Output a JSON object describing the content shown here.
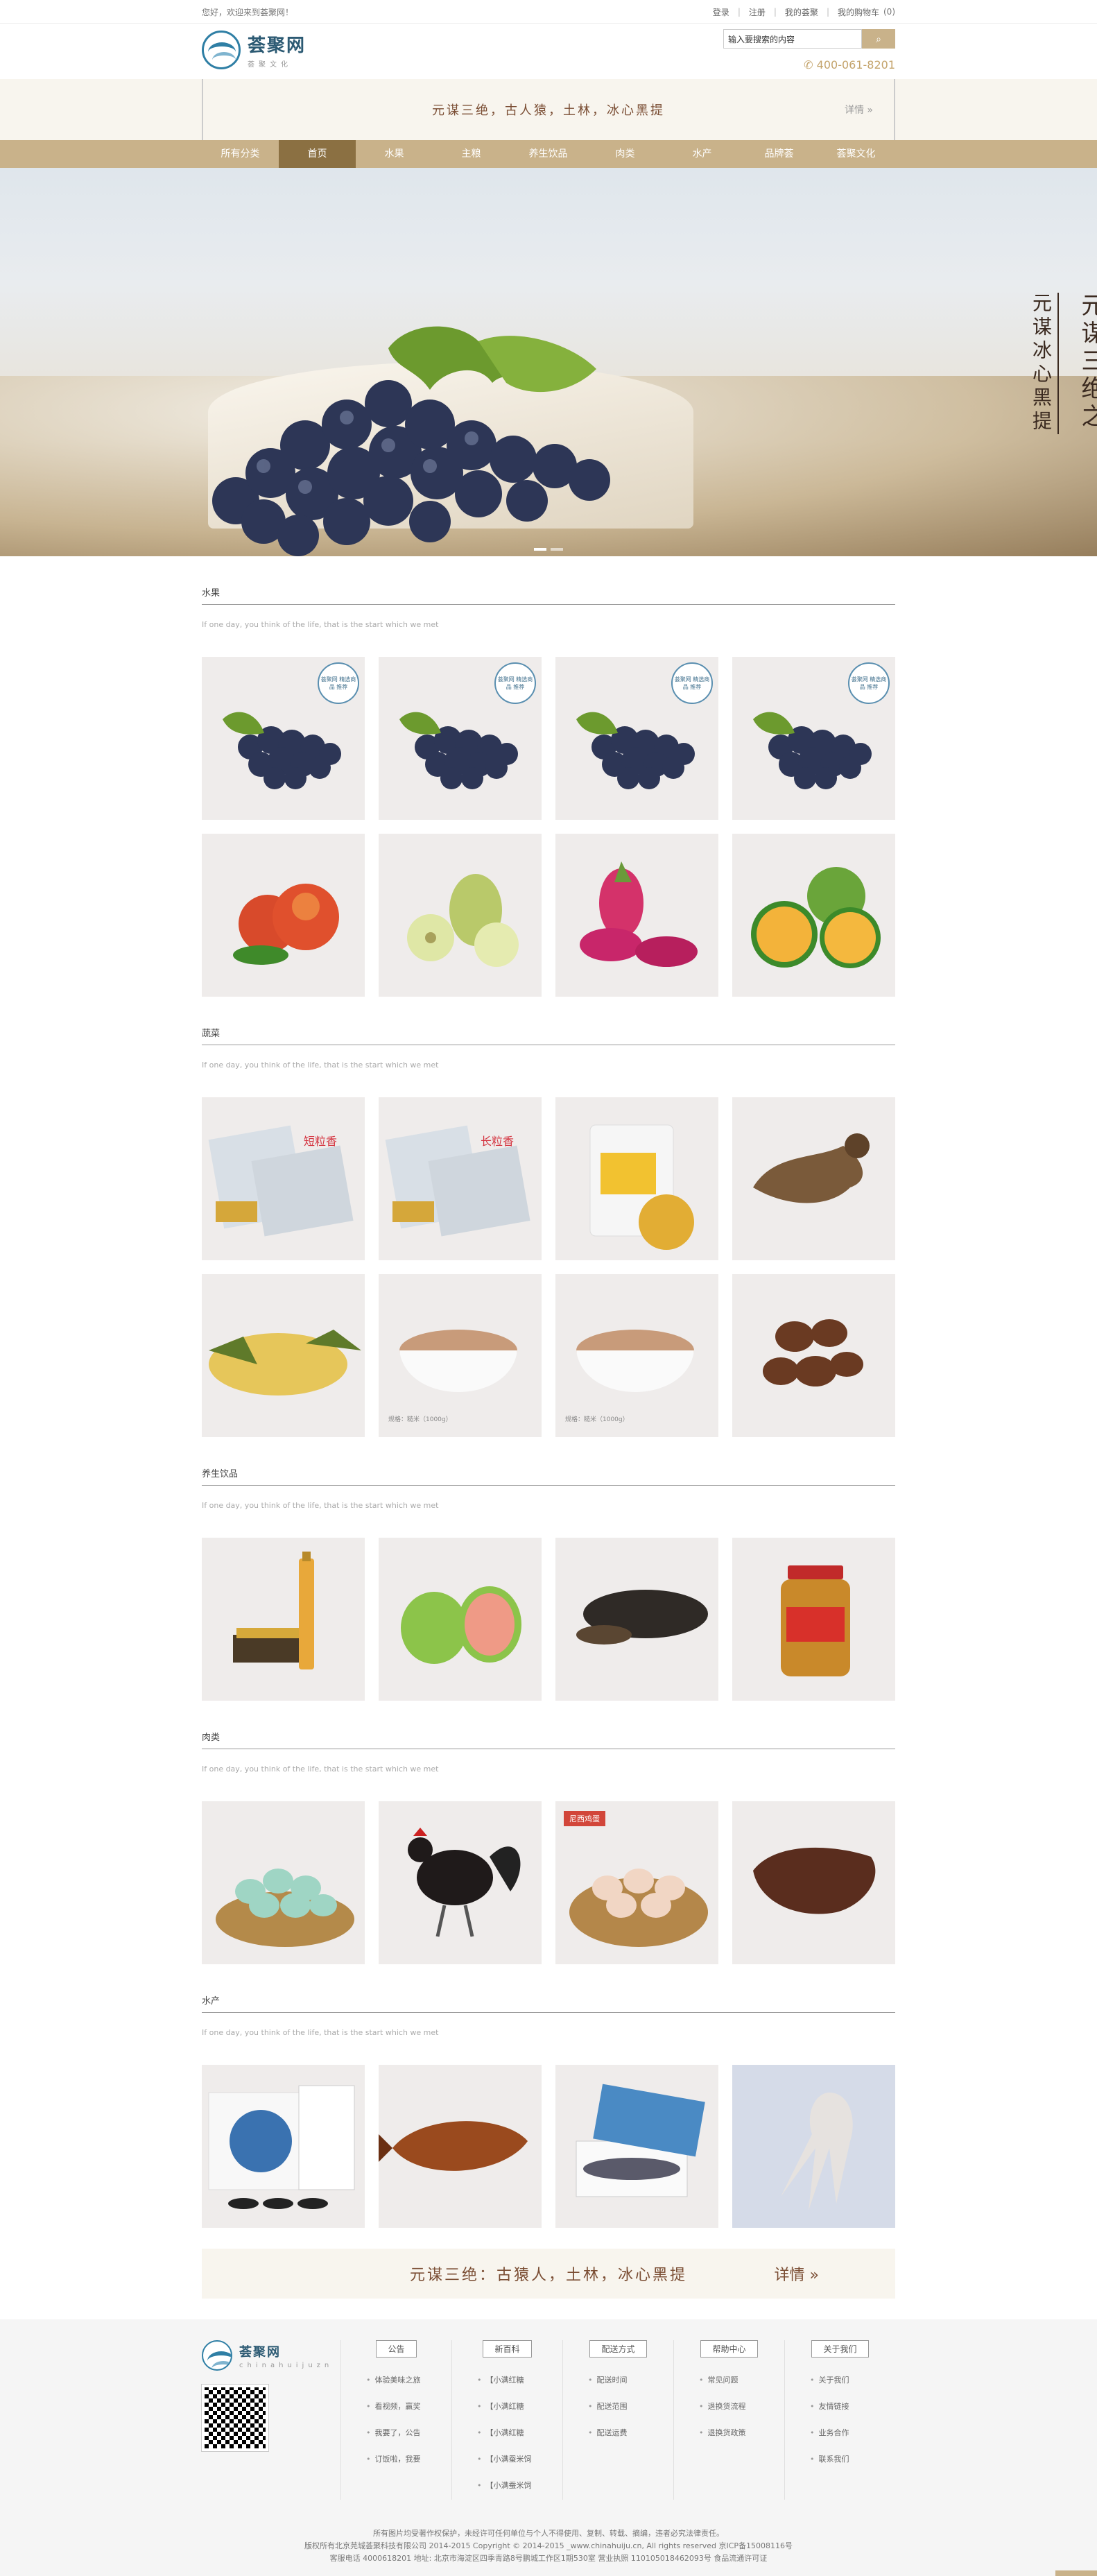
{
  "topbar": {
    "welcome": "您好，欢迎来到荟聚网！",
    "links": [
      "登录",
      "注册",
      "我的荟聚",
      "我的购物车"
    ],
    "cart_count": "(0)"
  },
  "header": {
    "logo_name": "荟聚网",
    "logo_sub": "荟聚文化",
    "search_placeholder": "输入要搜索的内容",
    "search_value": "输入要搜索的内容",
    "hotline": "400-061-8201"
  },
  "promo": {
    "text": "元谋三绝，古人猿，土林，冰心黑提",
    "more": "详情 »"
  },
  "nav": [
    "所有分类",
    "首页",
    "水果",
    "主粮",
    "养生饮品",
    "肉类",
    "水产",
    "品牌荟",
    "荟聚文化"
  ],
  "nav_active": 1,
  "banner": {
    "line1": "元谋三绝之",
    "line2": "元谋冰心黑提"
  },
  "sections": [
    {
      "title": "水果",
      "sub": "If one day, you think of the life, that is the start which we met"
    },
    {
      "title": "蔬菜",
      "sub": "If one day, you think of the life, that is the start which we met"
    },
    {
      "title": "养生饮品",
      "sub": "If one day, you think of the life, that is the start which we met"
    },
    {
      "title": "肉类",
      "sub": "If one day, you think of the life, that is the start which we met"
    },
    {
      "title": "水产",
      "sub": "If one day, you think of the life, that is the start which we met"
    }
  ],
  "cards": {
    "badge": "荟聚网\n精选商品\n推荐",
    "rice1": "短粒香",
    "rice2": "长粒香",
    "rice_caption": "规格：糙米（1000g）",
    "chicken_tag": "尼西鸡蛋"
  },
  "promo2": {
    "text": "元谋三绝：古猿人，土林，冰心黑提",
    "more": "详情 »"
  },
  "footer": {
    "logo_name": "荟聚网",
    "logo_sub": "chinahuijuzn",
    "columns": [
      {
        "head": "公告",
        "items": [
          "体验美味之旅",
          "看视频，赢奖",
          "我要了，公告",
          "订饭啦，我要"
        ]
      },
      {
        "head": "新百科",
        "items": [
          "【小满红糖",
          "【小满红糖",
          "【小满红糖",
          "【小满蚕米饲",
          "【小满蚕米饲"
        ]
      },
      {
        "head": "配送方式",
        "items": [
          "配送时间",
          "配送范围",
          "配送运费"
        ]
      },
      {
        "head": "帮助中心",
        "items": [
          "常见问题",
          "退换货流程",
          "退换货政策"
        ]
      },
      {
        "head": "关于我们",
        "items": [
          "关于我们",
          "友情链接",
          "业务合作",
          "联系我们"
        ]
      }
    ],
    "line1": "所有图片均受著作权保护，未经许可任何单位与个人不得使用、复制、转载、摘编，违者必究法律责任。",
    "line2": "版权所有北京芫城荟聚科技有限公司 2014-2015 Copyright © 2014-2015 _www.chinahuiju.cn, All rights reserved 京ICP备15008116号",
    "line3": "客服电话 4000618201 地址: 北京市海淀区四季青路8号鹏城工作区1期530室 营业执照 110105018462093号 食品流通许可证"
  }
}
